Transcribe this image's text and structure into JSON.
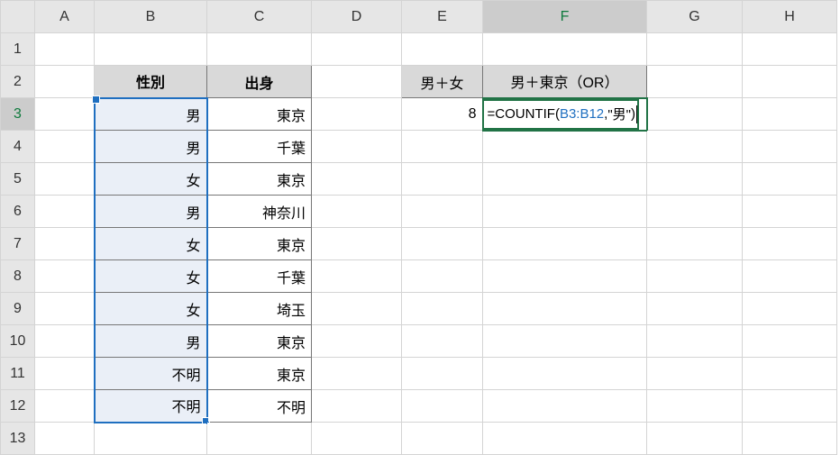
{
  "columns": [
    "A",
    "B",
    "C",
    "D",
    "E",
    "F",
    "G",
    "H"
  ],
  "rows": [
    "1",
    "2",
    "3",
    "4",
    "5",
    "6",
    "7",
    "8",
    "9",
    "10",
    "11",
    "12",
    "13"
  ],
  "headers": {
    "B2": "性別",
    "C2": "出身"
  },
  "dataB": [
    "男",
    "男",
    "女",
    "男",
    "女",
    "女",
    "女",
    "男",
    "不明",
    "不明"
  ],
  "dataC": [
    "東京",
    "千葉",
    "東京",
    "神奈川",
    "東京",
    "千葉",
    "埼玉",
    "東京",
    "東京",
    "不明"
  ],
  "E2": "男＋女",
  "F2": "男＋東京（OR）",
  "E3": "8",
  "formula": {
    "eq": "=",
    "func": "COUNTIF",
    "open": "(",
    "ref": "B3:B12",
    "comma": ",",
    "arg": "\"男\"",
    "close": ")"
  },
  "active_cell": "F3",
  "selected_range": "B3:B12",
  "chart_data": null
}
